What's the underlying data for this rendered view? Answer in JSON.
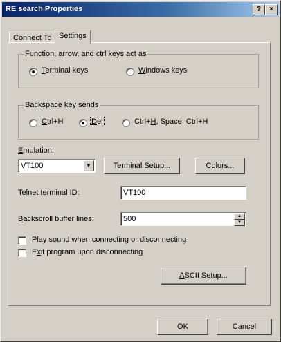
{
  "window": {
    "title": "RE search Properties",
    "help_glyph": "?",
    "close_glyph": "×"
  },
  "tabs": [
    {
      "label": "Connect To"
    },
    {
      "label": "Settings",
      "selected": true
    }
  ],
  "function_keys": {
    "label": "Function, arrow, and ctrl keys act as",
    "options": [
      {
        "label_u": "T",
        "label_rest": "erminal keys",
        "selected": true
      },
      {
        "label_u": "W",
        "label_rest": "indows keys",
        "selected": false
      }
    ]
  },
  "backspace": {
    "label": "Backspace key sends",
    "options": [
      {
        "label_u": "C",
        "label_rest": "trl+H",
        "selected": false
      },
      {
        "label_u": "D",
        "label_rest": "el",
        "selected": true
      },
      {
        "label_pre": "Ctrl+",
        "label_u": "H",
        "label_rest": ", Space, Ctrl+H",
        "selected": false
      }
    ]
  },
  "emulation": {
    "label_u": "E",
    "label_rest": "mulation:",
    "value": "VT100",
    "terminal_setup_u": "Terminal ",
    "terminal_setup_rest": "Setup...",
    "colors_pre": "C",
    "colors_u": "o",
    "colors_rest": "lors..."
  },
  "telnet_id": {
    "label_pre": "Te",
    "label_u": "l",
    "label_rest": "net terminal ID:",
    "value": "VT100"
  },
  "backscroll": {
    "label_u": "B",
    "label_rest": "ackscroll buffer lines:",
    "value": "500"
  },
  "checkboxes": [
    {
      "label_u": "P",
      "label_rest": "lay sound when connecting or disconnecting",
      "checked": false
    },
    {
      "label_pre": "E",
      "label_u": "x",
      "label_rest": "it program upon disconnecting",
      "checked": false
    }
  ],
  "ascii_setup": {
    "label_u": "A",
    "label_rest": "SCII Setup..."
  },
  "footer": {
    "ok": "OK",
    "cancel": "Cancel"
  }
}
